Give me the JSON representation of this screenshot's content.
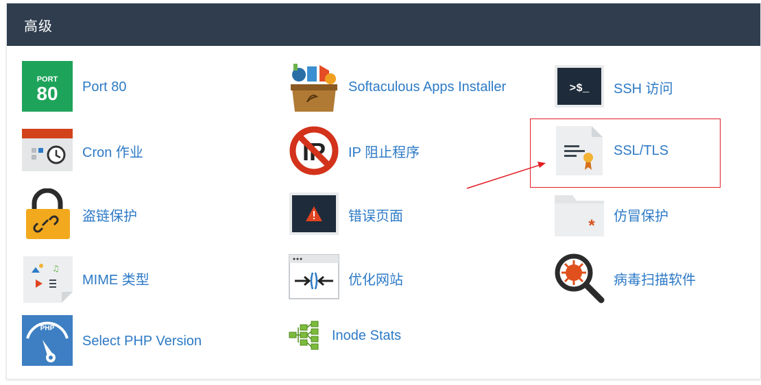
{
  "panel": {
    "title": "高级"
  },
  "items": [
    {
      "key": "port80",
      "label": "Port 80",
      "icon": "port-80-icon",
      "icon_text_top": "PORT",
      "icon_text_bottom": "80"
    },
    {
      "key": "softaculous",
      "label": "Softaculous Apps Installer",
      "icon": "softaculous-icon"
    },
    {
      "key": "ssh",
      "label": "SSH 访问",
      "icon": "terminal-icon",
      "icon_text": ">$_"
    },
    {
      "key": "cron",
      "label": "Cron 作业",
      "icon": "calendar-clock-icon"
    },
    {
      "key": "ipblock",
      "label": "IP 阻止程序",
      "icon": "ip-block-icon",
      "icon_text": "IP"
    },
    {
      "key": "ssl",
      "label": "SSL/TLS",
      "icon": "certificate-icon"
    },
    {
      "key": "hotlink",
      "label": "盗链保护",
      "icon": "padlock-link-icon"
    },
    {
      "key": "errorpages",
      "label": "错误页面",
      "icon": "error-warning-icon"
    },
    {
      "key": "leech",
      "label": "仿冒保护",
      "icon": "folder-asterisk-icon"
    },
    {
      "key": "mime",
      "label": "MIME 类型",
      "icon": "mime-file-icon"
    },
    {
      "key": "optimize",
      "label": "优化网站",
      "icon": "optimize-compress-icon"
    },
    {
      "key": "virus",
      "label": "病毒扫描软件",
      "icon": "virus-magnifier-icon"
    },
    {
      "key": "php",
      "label": "Select PHP Version",
      "icon": "php-gauge-icon",
      "icon_text": "PHP"
    },
    {
      "key": "inode",
      "label": "Inode Stats",
      "icon": "inode-tree-icon"
    }
  ],
  "colors": {
    "header_bg": "#2f3d4f",
    "link": "#2d7ac6",
    "port80_green": "#1ea45a",
    "annotation_red": "#e31b23"
  }
}
